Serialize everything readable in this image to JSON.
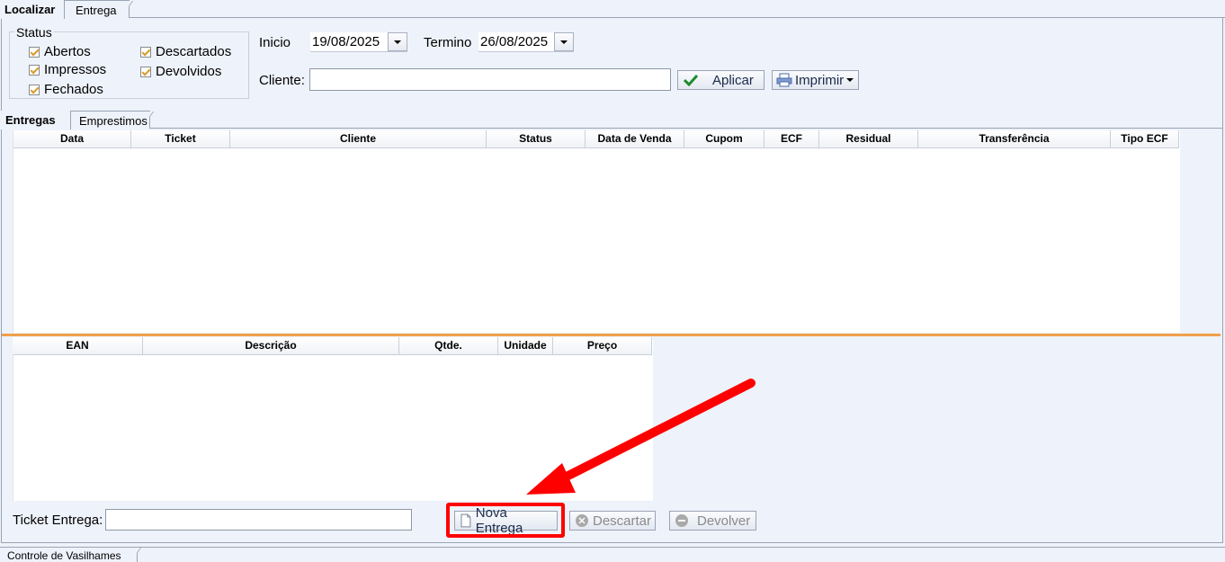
{
  "top_tabs": {
    "localizar": "Localizar",
    "entrega": "Entrega"
  },
  "status": {
    "legend": "Status",
    "items": [
      {
        "label": "Abertos",
        "checked": true
      },
      {
        "label": "Impressos",
        "checked": true
      },
      {
        "label": "Fechados",
        "checked": true
      },
      {
        "label": "Descartados",
        "checked": true
      },
      {
        "label": "Devolvidos",
        "checked": true
      }
    ]
  },
  "filters": {
    "inicio_label": "Inicio",
    "inicio_value": "19/08/2025",
    "termino_label": "Termino",
    "termino_value": "26/08/2025",
    "cliente_label": "Cliente:",
    "cliente_value": ""
  },
  "buttons": {
    "aplicar": "Aplicar",
    "imprimir": "Imprimir"
  },
  "mid_tabs": {
    "entregas": "Entregas",
    "emprestimos": "Emprestimos"
  },
  "entregas_grid": {
    "columns": [
      "Data",
      "Ticket",
      "Cliente",
      "Status",
      "Data de Venda",
      "Cupom",
      "ECF",
      "Residual",
      "Transferência",
      "Tipo ECF"
    ],
    "rows": []
  },
  "itens_grid": {
    "columns": [
      "EAN",
      "Descrição",
      "Qtde.",
      "Unidade",
      "Preço"
    ],
    "rows": []
  },
  "footer": {
    "ticket_label": "Ticket Entrega:",
    "ticket_value": "",
    "nova_entrega": "Nova Entrega",
    "descartar": "Descartar",
    "devolver": "Devolver"
  },
  "bottom_tab": "Controle de Vasilhames",
  "colors": {
    "highlight": "#ff0000",
    "splitter": "#f0a04b",
    "check": "#d99a2b"
  }
}
